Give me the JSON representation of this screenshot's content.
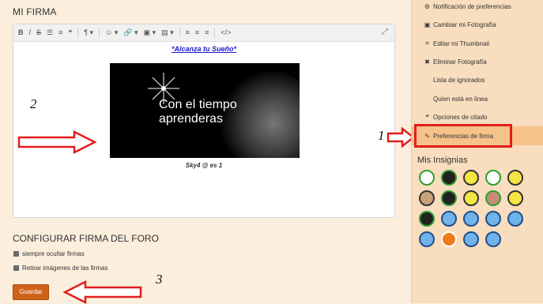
{
  "main": {
    "title": "MI FIRMA",
    "signature": {
      "link_text": "*Alcanza tu Sueño*",
      "image_text_line1": "Con el tiempo",
      "image_text_line2": "aprenderas",
      "caption": "Sky4 @ es 1"
    },
    "config_title": "CONFIGURAR FIRMA DEL FORO",
    "checkboxes": [
      {
        "label": "siempre ocultar firmas"
      },
      {
        "label": "Retirar imágenes de las firmas"
      }
    ],
    "save_label": "Guardar"
  },
  "toolbar": {
    "bold": "B",
    "italic": "I",
    "strike": "S",
    "ul": "☰",
    "ol": "≡",
    "quote": "❝",
    "paragraph": "¶ ▾",
    "emoji": "☺ ▾",
    "link": "🔗 ▾",
    "image": "▣ ▾",
    "media": "▤ ▾",
    "align_left": "≡",
    "align_center": "≡",
    "align_right": "≡",
    "source": "</>",
    "expand": "⤢"
  },
  "annotations": {
    "a1": "1",
    "a2": "2",
    "a3": "3"
  },
  "sidebar": {
    "items": [
      {
        "label": "Notificación de preferencias",
        "icon": "gear-icon"
      },
      {
        "label": "Cambiar mi Fotografía",
        "icon": "image-icon"
      },
      {
        "label": "Editar mi Thumbnail",
        "icon": "crop-icon"
      },
      {
        "label": "Eliminar Fotografía",
        "icon": "trash-icon"
      },
      {
        "label": "Lista de ignorados",
        "icon": ""
      },
      {
        "label": "Quien está en linea",
        "icon": ""
      },
      {
        "label": "Opciones de citado",
        "icon": "quote-icon"
      },
      {
        "label": "Preferencias de firma",
        "icon": "pencil-icon"
      }
    ],
    "badges_title": "Mis Insignias"
  },
  "colors": {
    "accent": "#d0621a",
    "highlight": "#e21d1d",
    "active_item": "#f5c28a",
    "sidebar_bg": "#f8ddbe",
    "page_bg": "#fbeedd"
  }
}
